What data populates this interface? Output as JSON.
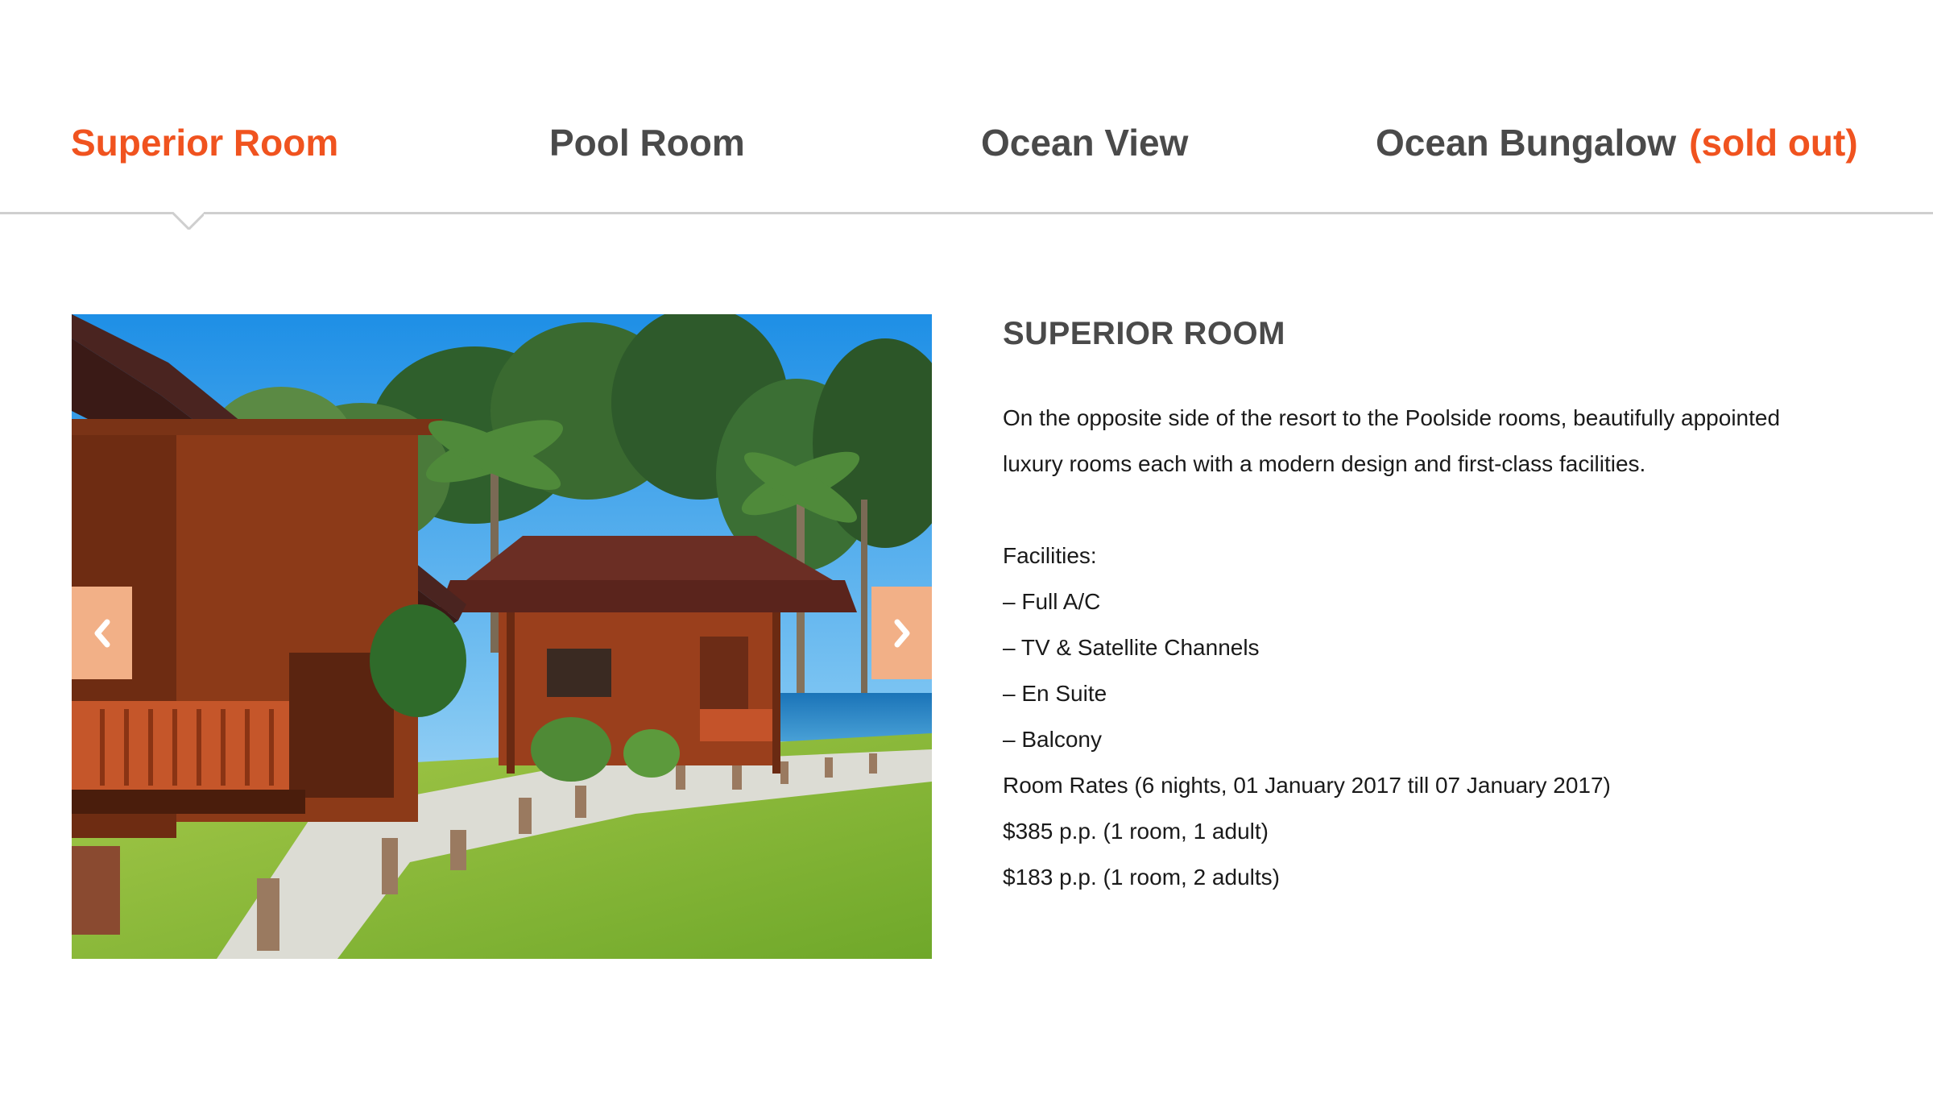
{
  "tabs": [
    {
      "label": "Superior Room",
      "active": true
    },
    {
      "label": "Pool Room",
      "active": false
    },
    {
      "label": "Ocean View",
      "active": false
    },
    {
      "label": "Ocean Bungalow",
      "suffix": "(sold out)",
      "active": false
    }
  ],
  "slider": {
    "prev_icon": "chevron-left-icon",
    "next_icon": "chevron-right-icon",
    "image_description": "wooden bungalows with palm trees by the sea"
  },
  "room": {
    "title": "SUPERIOR ROOM",
    "description_line1": "On the opposite side of the resort to the Poolside rooms, beautifully appointed",
    "description_line2": "luxury rooms each with a modern design and first-class facilities.",
    "facilities_label": "Facilities:",
    "facilities": [
      "– Full A/C",
      "– TV & Satellite Channels",
      "– En Suite",
      "– Balcony"
    ],
    "rates_label": "Room Rates (6 nights, 01 January 2017 till 07 January 2017)",
    "rates": [
      "$385 p.p. (1 room, 1 adult)",
      "$183 p.p. (1 room, 2 adults)"
    ]
  },
  "colors": {
    "accent": "#f0531f",
    "tab_text": "#4a4a4a",
    "nav_button": "#f2b087"
  }
}
